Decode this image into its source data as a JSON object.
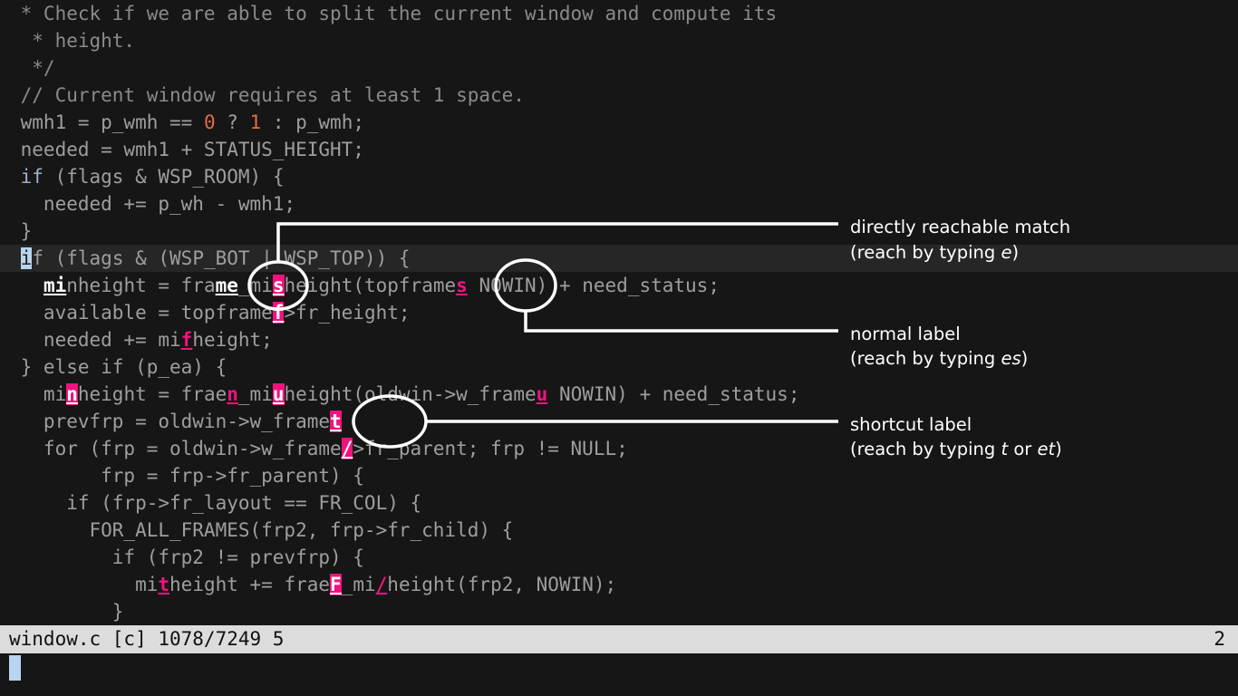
{
  "editor": {
    "app": "vim",
    "lines": [
      {
        "indent": "  ",
        "segments": [
          {
            "t": " * Check if we are able to split the current window and compute its",
            "c": "tok-comment"
          }
        ]
      },
      {
        "indent": "",
        "segments": [
          {
            "t": "  * height.",
            "c": "tok-comment"
          }
        ]
      },
      {
        "indent": "",
        "segments": [
          {
            "t": "  */",
            "c": "tok-comment"
          }
        ]
      },
      {
        "indent": "",
        "segments": [
          {
            "t": " // Current window requires at least 1 space.",
            "c": "tok-comment"
          }
        ]
      },
      {
        "indent": "",
        "segments": [
          {
            "t": " wmh1 = p_wmh == ",
            "c": "tok-plain"
          },
          {
            "t": "0",
            "c": "tok-num"
          },
          {
            "t": " ? ",
            "c": "tok-plain"
          },
          {
            "t": "1",
            "c": "tok-num"
          },
          {
            "t": " : p_wmh;",
            "c": "tok-plain"
          }
        ]
      },
      {
        "indent": "",
        "segments": [
          {
            "t": " needed = wmh1 + STATUS_HEIGHT;",
            "c": "tok-plain"
          }
        ]
      },
      {
        "indent": "",
        "segments": [
          {
            "t": " ",
            "c": "tok-plain"
          },
          {
            "t": "if",
            "c": "tok-kw"
          },
          {
            "t": " (flags & WSP_ROOM) {",
            "c": "tok-plain"
          }
        ]
      },
      {
        "indent": "",
        "segments": [
          {
            "t": "   needed += p_wh - wmh1;",
            "c": "tok-plain"
          }
        ]
      },
      {
        "indent": "",
        "segments": [
          {
            "t": " }",
            "c": "tok-plain"
          }
        ]
      },
      {
        "cursorline": true,
        "indent": "",
        "segments": [
          {
            "t": " ",
            "c": "tok-plain"
          },
          {
            "t": "i",
            "c": "cursor-block"
          },
          {
            "t": "f (flags & (WSP_BOT | WSP_TOP)) {",
            "c": "tok-plain"
          }
        ]
      },
      {
        "indent": "",
        "segments": [
          {
            "t": "   ",
            "c": "tok-plain"
          },
          {
            "t": "mi",
            "c": "lbl-direct"
          },
          {
            "t": "nheight = fra",
            "c": "tok-plain"
          },
          {
            "t": "me",
            "c": "lbl-direct"
          },
          {
            "t": "_mi",
            "c": "tok-plain"
          },
          {
            "t": "s",
            "c": "lbl-shortcut"
          },
          {
            "t": "height(topframe",
            "c": "tok-plain"
          },
          {
            "t": "s",
            "c": "lbl-normal"
          },
          {
            "t": " NOWIN) + need_status;",
            "c": "tok-plain"
          }
        ]
      },
      {
        "indent": "",
        "segments": [
          {
            "t": "   available = topframe",
            "c": "tok-plain"
          },
          {
            "t": "f",
            "c": "lbl-shortcut"
          },
          {
            "t": ">fr_height;",
            "c": "tok-plain"
          }
        ]
      },
      {
        "indent": "",
        "segments": [
          {
            "t": "   needed += mi",
            "c": "tok-plain"
          },
          {
            "t": "f",
            "c": "lbl-normal"
          },
          {
            "t": "height;",
            "c": "tok-plain"
          }
        ]
      },
      {
        "indent": "",
        "segments": [
          {
            "t": " } else if (p_ea) {",
            "c": "tok-plain"
          }
        ]
      },
      {
        "indent": "",
        "segments": [
          {
            "t": "   mi",
            "c": "tok-plain"
          },
          {
            "t": "n",
            "c": "lbl-shortcut"
          },
          {
            "t": "height = frae",
            "c": "tok-plain"
          },
          {
            "t": "n",
            "c": "lbl-normal"
          },
          {
            "t": "_mi",
            "c": "tok-plain"
          },
          {
            "t": "u",
            "c": "lbl-shortcut"
          },
          {
            "t": "height(oldwin->w_frame",
            "c": "tok-plain"
          },
          {
            "t": "u",
            "c": "lbl-normal"
          },
          {
            "t": " NOWIN) + need_status;",
            "c": "tok-plain"
          }
        ]
      },
      {
        "indent": "",
        "segments": [
          {
            "t": "   prevfrp = oldwin->w_frame",
            "c": "tok-plain"
          },
          {
            "t": "t",
            "c": "lbl-shortcut"
          },
          {
            "t": "",
            "c": "tok-plain"
          }
        ]
      },
      {
        "indent": "",
        "segments": [
          {
            "t": "   for (frp = oldwin->w_frame",
            "c": "tok-plain"
          },
          {
            "t": "/",
            "c": "lbl-shortcut"
          },
          {
            "t": ">fr_parent; frp != NULL;",
            "c": "tok-plain"
          }
        ]
      },
      {
        "indent": "",
        "segments": [
          {
            "t": "        frp = frp->fr_parent) {",
            "c": "tok-plain"
          }
        ]
      },
      {
        "indent": "",
        "segments": [
          {
            "t": "     if (frp->fr_layout == FR_COL) {",
            "c": "tok-plain"
          }
        ]
      },
      {
        "indent": "",
        "segments": [
          {
            "t": "       FOR_ALL_FRAMES(frp2, frp->fr_child) {",
            "c": "tok-plain"
          }
        ]
      },
      {
        "indent": "",
        "segments": [
          {
            "t": "         if (frp2 != prevfrp) {",
            "c": "tok-plain"
          }
        ]
      },
      {
        "indent": "",
        "segments": [
          {
            "t": "           mi",
            "c": "tok-plain"
          },
          {
            "t": "t",
            "c": "lbl-normal"
          },
          {
            "t": "height += frae",
            "c": "tok-plain"
          },
          {
            "t": "F",
            "c": "lbl-shortcut"
          },
          {
            "t": "_mi",
            "c": "tok-plain"
          },
          {
            "t": "/",
            "c": "lbl-normal"
          },
          {
            "t": "height(frp2, NOWIN);",
            "c": "tok-plain"
          }
        ]
      },
      {
        "indent": "",
        "segments": [
          {
            "t": "         }",
            "c": "tok-plain"
          }
        ]
      }
    ]
  },
  "statusline": {
    "filename": "window.c",
    "filetype": "[c]",
    "position": "1078/7249",
    "column": "5",
    "left_text": "window.c [c] 1078/7249 5",
    "right_text": "2"
  },
  "annotations": [
    {
      "id": "directly-reachable-match",
      "title": "directly reachable match",
      "sub_prefix": "(reach by typing ",
      "sub_key": "e",
      "sub_suffix": ")"
    },
    {
      "id": "normal-label",
      "title": "normal label",
      "sub_prefix": "(reach by typing ",
      "sub_key": "es",
      "sub_suffix": ")"
    },
    {
      "id": "shortcut-label",
      "title": "shortcut label",
      "sub_prefix": "(reach by typing ",
      "sub_key": "t",
      "sub_mid": " or ",
      "sub_key2": "et",
      "sub_suffix": ")"
    }
  ],
  "colors": {
    "background": "#161616",
    "label_pink": "#f0137d",
    "label_white": "#ffffff",
    "cursor_blue": "#b9d4ef",
    "status_bg": "#dcdcdc",
    "comment_gray": "#8a8a8a",
    "number_orange": "#e06c4a",
    "keyword_blue": "#9fb0c8",
    "annotation_white": "#ffffff"
  }
}
